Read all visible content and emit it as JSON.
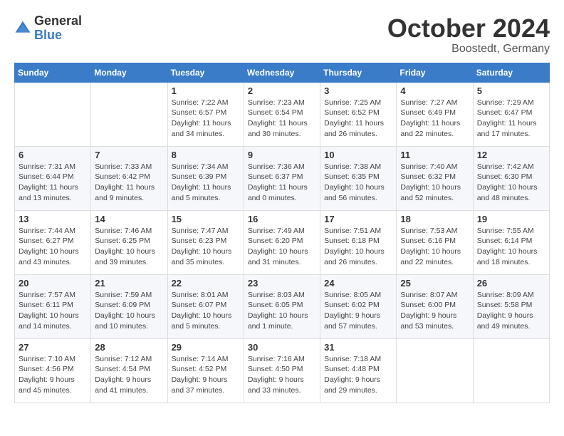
{
  "header": {
    "logo_general": "General",
    "logo_blue": "Blue",
    "month": "October 2024",
    "location": "Boostedt, Germany"
  },
  "calendar": {
    "days_of_week": [
      "Sunday",
      "Monday",
      "Tuesday",
      "Wednesday",
      "Thursday",
      "Friday",
      "Saturday"
    ],
    "weeks": [
      [
        {
          "day": "",
          "detail": ""
        },
        {
          "day": "",
          "detail": ""
        },
        {
          "day": "1",
          "detail": "Sunrise: 7:22 AM\nSunset: 6:57 PM\nDaylight: 11 hours\nand 34 minutes."
        },
        {
          "day": "2",
          "detail": "Sunrise: 7:23 AM\nSunset: 6:54 PM\nDaylight: 11 hours\nand 30 minutes."
        },
        {
          "day": "3",
          "detail": "Sunrise: 7:25 AM\nSunset: 6:52 PM\nDaylight: 11 hours\nand 26 minutes."
        },
        {
          "day": "4",
          "detail": "Sunrise: 7:27 AM\nSunset: 6:49 PM\nDaylight: 11 hours\nand 22 minutes."
        },
        {
          "day": "5",
          "detail": "Sunrise: 7:29 AM\nSunset: 6:47 PM\nDaylight: 11 hours\nand 17 minutes."
        }
      ],
      [
        {
          "day": "6",
          "detail": "Sunrise: 7:31 AM\nSunset: 6:44 PM\nDaylight: 11 hours\nand 13 minutes."
        },
        {
          "day": "7",
          "detail": "Sunrise: 7:33 AM\nSunset: 6:42 PM\nDaylight: 11 hours\nand 9 minutes."
        },
        {
          "day": "8",
          "detail": "Sunrise: 7:34 AM\nSunset: 6:39 PM\nDaylight: 11 hours\nand 5 minutes."
        },
        {
          "day": "9",
          "detail": "Sunrise: 7:36 AM\nSunset: 6:37 PM\nDaylight: 11 hours\nand 0 minutes."
        },
        {
          "day": "10",
          "detail": "Sunrise: 7:38 AM\nSunset: 6:35 PM\nDaylight: 10 hours\nand 56 minutes."
        },
        {
          "day": "11",
          "detail": "Sunrise: 7:40 AM\nSunset: 6:32 PM\nDaylight: 10 hours\nand 52 minutes."
        },
        {
          "day": "12",
          "detail": "Sunrise: 7:42 AM\nSunset: 6:30 PM\nDaylight: 10 hours\nand 48 minutes."
        }
      ],
      [
        {
          "day": "13",
          "detail": "Sunrise: 7:44 AM\nSunset: 6:27 PM\nDaylight: 10 hours\nand 43 minutes."
        },
        {
          "day": "14",
          "detail": "Sunrise: 7:46 AM\nSunset: 6:25 PM\nDaylight: 10 hours\nand 39 minutes."
        },
        {
          "day": "15",
          "detail": "Sunrise: 7:47 AM\nSunset: 6:23 PM\nDaylight: 10 hours\nand 35 minutes."
        },
        {
          "day": "16",
          "detail": "Sunrise: 7:49 AM\nSunset: 6:20 PM\nDaylight: 10 hours\nand 31 minutes."
        },
        {
          "day": "17",
          "detail": "Sunrise: 7:51 AM\nSunset: 6:18 PM\nDaylight: 10 hours\nand 26 minutes."
        },
        {
          "day": "18",
          "detail": "Sunrise: 7:53 AM\nSunset: 6:16 PM\nDaylight: 10 hours\nand 22 minutes."
        },
        {
          "day": "19",
          "detail": "Sunrise: 7:55 AM\nSunset: 6:14 PM\nDaylight: 10 hours\nand 18 minutes."
        }
      ],
      [
        {
          "day": "20",
          "detail": "Sunrise: 7:57 AM\nSunset: 6:11 PM\nDaylight: 10 hours\nand 14 minutes."
        },
        {
          "day": "21",
          "detail": "Sunrise: 7:59 AM\nSunset: 6:09 PM\nDaylight: 10 hours\nand 10 minutes."
        },
        {
          "day": "22",
          "detail": "Sunrise: 8:01 AM\nSunset: 6:07 PM\nDaylight: 10 hours\nand 5 minutes."
        },
        {
          "day": "23",
          "detail": "Sunrise: 8:03 AM\nSunset: 6:05 PM\nDaylight: 10 hours\nand 1 minute."
        },
        {
          "day": "24",
          "detail": "Sunrise: 8:05 AM\nSunset: 6:02 PM\nDaylight: 9 hours\nand 57 minutes."
        },
        {
          "day": "25",
          "detail": "Sunrise: 8:07 AM\nSunset: 6:00 PM\nDaylight: 9 hours\nand 53 minutes."
        },
        {
          "day": "26",
          "detail": "Sunrise: 8:09 AM\nSunset: 5:58 PM\nDaylight: 9 hours\nand 49 minutes."
        }
      ],
      [
        {
          "day": "27",
          "detail": "Sunrise: 7:10 AM\nSunset: 4:56 PM\nDaylight: 9 hours\nand 45 minutes."
        },
        {
          "day": "28",
          "detail": "Sunrise: 7:12 AM\nSunset: 4:54 PM\nDaylight: 9 hours\nand 41 minutes."
        },
        {
          "day": "29",
          "detail": "Sunrise: 7:14 AM\nSunset: 4:52 PM\nDaylight: 9 hours\nand 37 minutes."
        },
        {
          "day": "30",
          "detail": "Sunrise: 7:16 AM\nSunset: 4:50 PM\nDaylight: 9 hours\nand 33 minutes."
        },
        {
          "day": "31",
          "detail": "Sunrise: 7:18 AM\nSunset: 4:48 PM\nDaylight: 9 hours\nand 29 minutes."
        },
        {
          "day": "",
          "detail": ""
        },
        {
          "day": "",
          "detail": ""
        }
      ]
    ]
  }
}
